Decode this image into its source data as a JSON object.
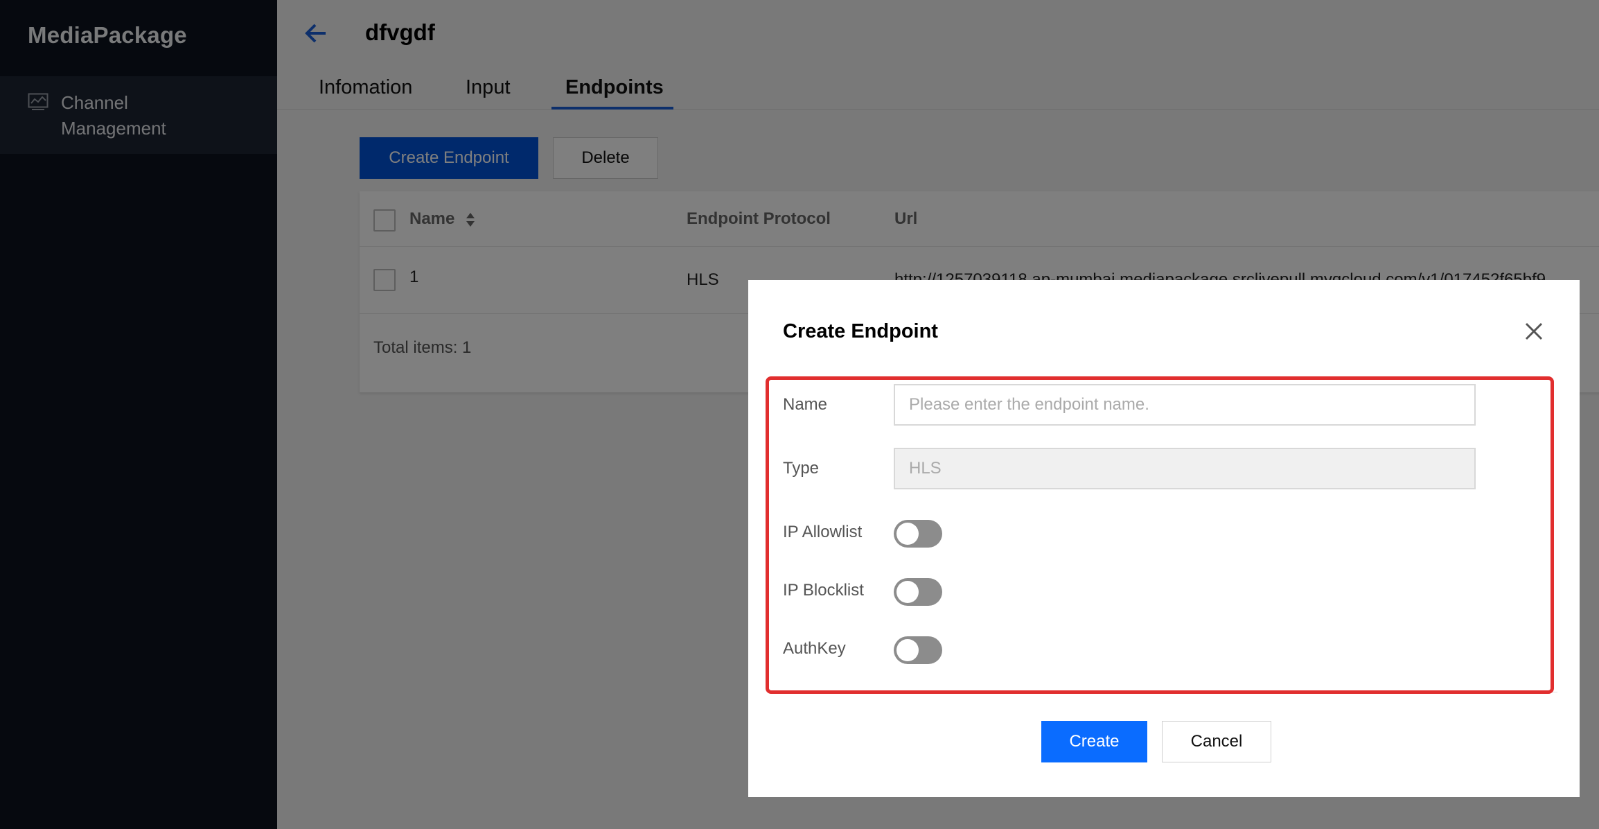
{
  "sidebar": {
    "brand": "MediaPackage",
    "items": [
      {
        "label": "Channel Management",
        "icon": "monitor-chart-icon"
      }
    ]
  },
  "header": {
    "title": "dfvgdf",
    "back_icon": "arrow-left-icon"
  },
  "tabs": [
    {
      "label": "Infomation",
      "active": false
    },
    {
      "label": "Input",
      "active": false
    },
    {
      "label": "Endpoints",
      "active": true
    }
  ],
  "toolbar": {
    "create_label": "Create Endpoint",
    "delete_label": "Delete"
  },
  "table": {
    "columns": [
      "Name",
      "Endpoint Protocol",
      "Url"
    ],
    "rows": [
      {
        "name": "1",
        "protocol": "HLS",
        "url": "http://1257039118.ap-mumbai.mediapackage.srclivepull.myqcloud.com/v1/017452f65bf9"
      }
    ],
    "total_label": "Total items:",
    "total_count": "1"
  },
  "modal": {
    "title": "Create Endpoint",
    "fields": {
      "name_label": "Name",
      "name_placeholder": "Please enter the endpoint name.",
      "type_label": "Type",
      "type_value": "HLS",
      "ip_allowlist_label": "IP Allowlist",
      "ip_blocklist_label": "IP Blocklist",
      "authkey_label": "AuthKey"
    },
    "toggles": {
      "ip_allowlist": false,
      "ip_blocklist": false,
      "authkey": false
    },
    "create_label": "Create",
    "cancel_label": "Cancel"
  },
  "colors": {
    "primary": "#0052d9",
    "highlight": "#e12e2e",
    "sidebar_bg": "#0d131f"
  }
}
